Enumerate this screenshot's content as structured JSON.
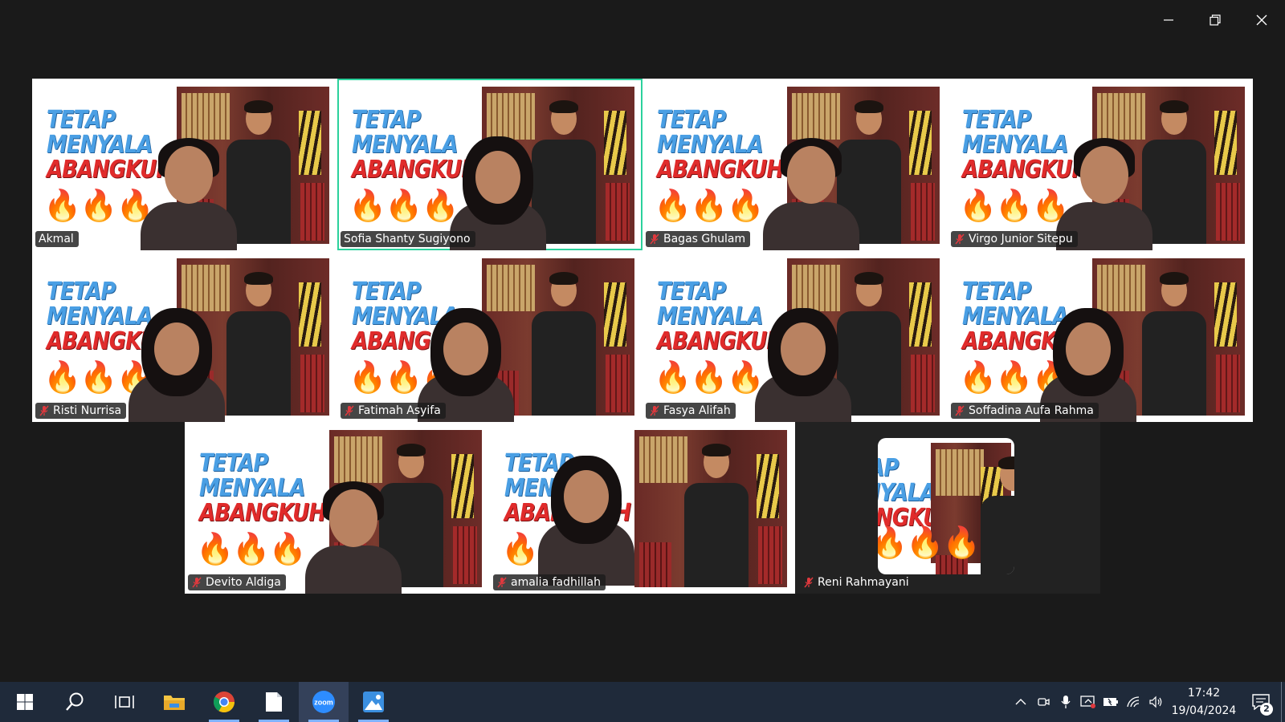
{
  "window": {
    "controls": [
      "minimize-icon",
      "restore-icon",
      "close-icon"
    ]
  },
  "poster": {
    "line1": "TETAP",
    "line2": "MENYALA",
    "line3": "ABANGKUH"
  },
  "participants": [
    {
      "name": "Akmal",
      "muted": false,
      "active": false,
      "video": true
    },
    {
      "name": "Sofia Shanty Sugiyono",
      "muted": false,
      "active": true,
      "video": true
    },
    {
      "name": "Bagas Ghulam",
      "muted": true,
      "active": false,
      "video": true
    },
    {
      "name": "Virgo Junior Sitepu",
      "muted": true,
      "active": false,
      "video": true
    },
    {
      "name": "Risti Nurrisa",
      "muted": true,
      "active": false,
      "video": true
    },
    {
      "name": "Fatimah Asyifa",
      "muted": true,
      "active": false,
      "video": true
    },
    {
      "name": "Fasya Alifah",
      "muted": true,
      "active": false,
      "video": true
    },
    {
      "name": "Soffadina Aufa Rahma",
      "muted": true,
      "active": false,
      "video": true
    },
    {
      "name": "Devito Aldiga",
      "muted": true,
      "active": false,
      "video": true
    },
    {
      "name": "amalia fadhillah",
      "muted": true,
      "active": false,
      "video": true
    },
    {
      "name": "Reni Rahmayani",
      "muted": true,
      "active": false,
      "video": false
    }
  ],
  "taskbar": {
    "items": [
      {
        "icon": "windows-start-icon",
        "active": false,
        "running": false
      },
      {
        "icon": "search-icon",
        "active": false,
        "running": false
      },
      {
        "icon": "task-view-icon",
        "active": false,
        "running": false
      },
      {
        "icon": "file-explorer-icon",
        "active": false,
        "running": false
      },
      {
        "icon": "chrome-icon",
        "active": false,
        "running": true
      },
      {
        "icon": "notepad-icon",
        "active": false,
        "running": true
      },
      {
        "icon": "zoom-icon",
        "label": "zoom",
        "active": true,
        "running": true
      },
      {
        "icon": "photos-icon",
        "active": false,
        "running": true
      }
    ],
    "tray_icons": [
      "chevron-up-icon",
      "meet-now-icon",
      "microphone-icon",
      "screen-share-icon",
      "battery-icon",
      "wifi-icon",
      "volume-icon"
    ],
    "time": "17:42",
    "date": "19/04/2024",
    "notification_count": "2"
  },
  "colors": {
    "background": "#1a1a1a",
    "active_speaker_border": "#2bd19c",
    "taskbar": "#1f2a3a",
    "mute_red": "#e0393e",
    "poster_blue": "#4a9fe4",
    "poster_red": "#e02b2b"
  }
}
